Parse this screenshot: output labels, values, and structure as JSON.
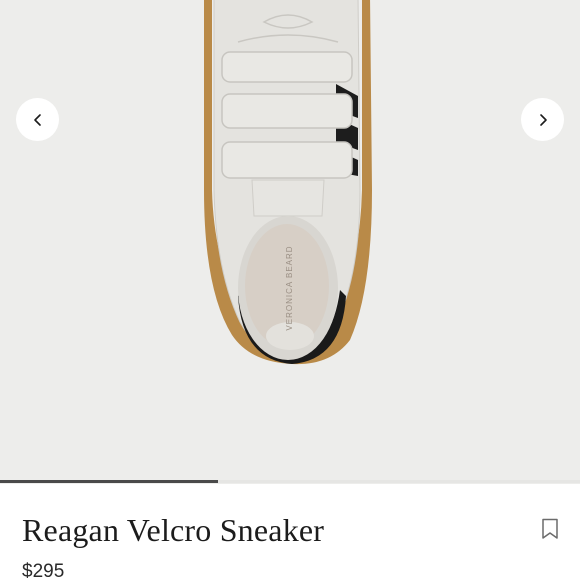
{
  "product": {
    "title": "Reagan Velcro Sneaker",
    "price": "$295",
    "insole_brand": "VERONICA BEARD"
  },
  "gallery": {
    "progress": 0.375,
    "prev_icon": "chevron-left-icon",
    "next_icon": "chevron-right-icon"
  },
  "actions": {
    "save_icon": "bookmark-icon"
  }
}
